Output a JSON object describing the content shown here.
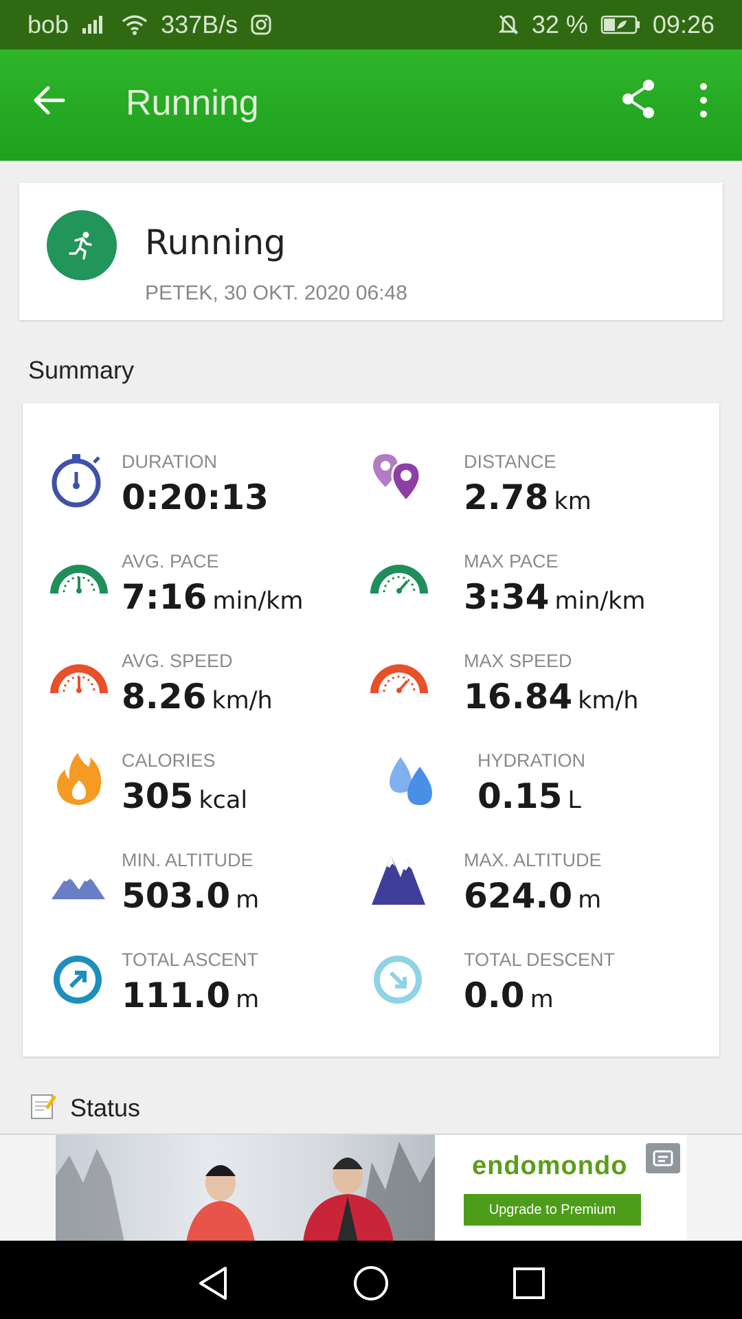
{
  "statusbar": {
    "carrier": "bob",
    "net_speed": "337B/s",
    "battery": "32 %",
    "time": "09:26"
  },
  "appbar": {
    "title": "Running",
    "icons": [
      "back-arrow-icon",
      "share-icon",
      "more-vert-icon"
    ]
  },
  "activity": {
    "title": "Running",
    "date": "PETEK, 30 OKT. 2020 06:48",
    "icon": "running-person-icon"
  },
  "summary": {
    "title": "Summary",
    "stats": [
      {
        "label": "DURATION",
        "value": "0:20:13",
        "unit": "",
        "icon": "stopwatch-icon",
        "color": "#3f51a8"
      },
      {
        "label": "DISTANCE",
        "value": "2.78",
        "unit": "km",
        "icon": "location-pins-icon",
        "color": "#8e3fa6"
      },
      {
        "label": "AVG. PACE",
        "value": "7:16",
        "unit": "min/km",
        "icon": "pace-gauge-icon",
        "color": "#1f8f5a"
      },
      {
        "label": "MAX PACE",
        "value": "3:34",
        "unit": "min/km",
        "icon": "pace-gauge-max-icon",
        "color": "#1f8f5a"
      },
      {
        "label": "AVG. SPEED",
        "value": "8.26",
        "unit": "km/h",
        "icon": "speed-gauge-icon",
        "color": "#e8502a"
      },
      {
        "label": "MAX SPEED",
        "value": "16.84",
        "unit": "km/h",
        "icon": "speed-gauge-max-icon",
        "color": "#e8502a"
      },
      {
        "label": "CALORIES",
        "value": "305",
        "unit": "kcal",
        "icon": "flame-icon",
        "color": "#f59a23"
      },
      {
        "label": "HYDRATION",
        "value": "0.15",
        "unit": "L",
        "icon": "water-drops-icon",
        "color": "#4a8fe6"
      },
      {
        "label": "MIN. ALTITUDE",
        "value": "503.0",
        "unit": "m",
        "icon": "mountains-low-icon",
        "color": "#6a7ec4"
      },
      {
        "label": "MAX. ALTITUDE",
        "value": "624.0",
        "unit": "m",
        "icon": "mountains-high-icon",
        "color": "#3f3f99"
      },
      {
        "label": "TOTAL ASCENT",
        "value": "111.0",
        "unit": "m",
        "icon": "ascent-arrow-icon",
        "color": "#1d8fbf"
      },
      {
        "label": "TOTAL DESCENT",
        "value": "0.0",
        "unit": "m",
        "icon": "descent-arrow-icon",
        "color": "#8fd3e6"
      }
    ]
  },
  "status": {
    "label": "Status",
    "icon": "note-edit-icon"
  },
  "ad": {
    "brand": "endomondo",
    "cta": "Upgrade to Premium",
    "icon": "ad-close-icon"
  },
  "navbar": {
    "icons": [
      "nav-back-icon",
      "nav-home-icon",
      "nav-recents-icon"
    ]
  }
}
